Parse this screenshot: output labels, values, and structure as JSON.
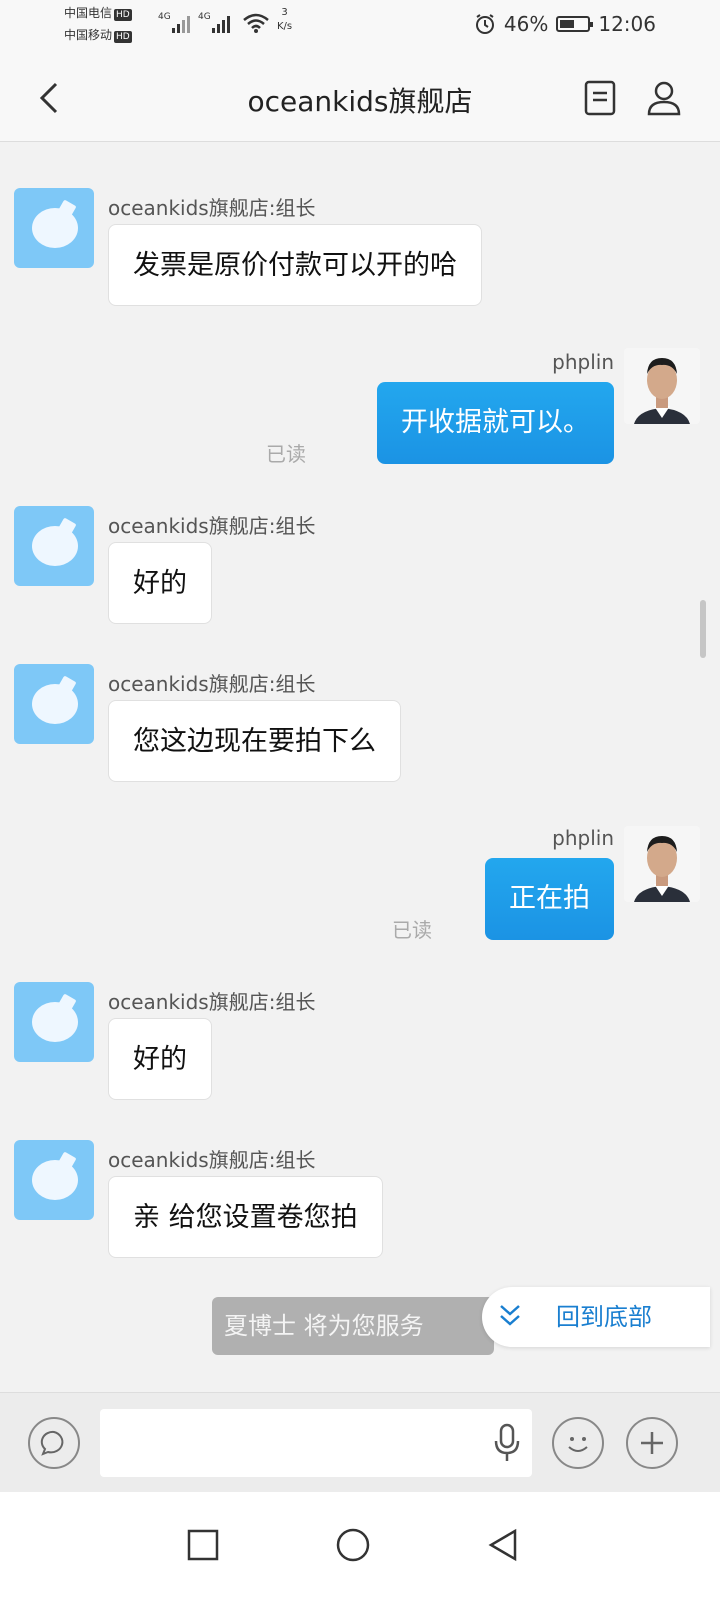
{
  "status_bar": {
    "carrier1": "中国电信",
    "carrier2": "中国移动",
    "hd": "HD",
    "net1": "4G",
    "net2": "4G",
    "speed_value": "3",
    "speed_unit": "K/s",
    "battery": "46%",
    "time": "12:06"
  },
  "header": {
    "title": "oceankids旗舰店",
    "back_icon": "chevron-left-icon",
    "menu_icon": "document-icon",
    "profile_icon": "person-icon"
  },
  "messages": [
    {
      "side": "left",
      "sender": "oceankids旗舰店:组长",
      "text": "发票是原价付款可以开的哈"
    },
    {
      "side": "right",
      "sender": "phplin",
      "text": "开收据就可以。",
      "status": "已读"
    },
    {
      "side": "left",
      "sender": "oceankids旗舰店:组长",
      "text": "好的"
    },
    {
      "side": "left",
      "sender": "oceankids旗舰店:组长",
      "text": "您这边现在要拍下么"
    },
    {
      "side": "right",
      "sender": "phplin",
      "text": "正在拍",
      "status": "已读"
    },
    {
      "side": "left",
      "sender": "oceankids旗舰店:组长",
      "text": "好的"
    },
    {
      "side": "left",
      "sender": "oceankids旗舰店:组长",
      "text": "亲 给您设置卷您拍"
    }
  ],
  "toast": "夏博士 将为您服务",
  "jump_bottom": "回到底部",
  "input": {
    "placeholder": ""
  },
  "colors": {
    "bubble_right": "#1b9ae8",
    "background": "#f2f2f2",
    "accent": "#1a7fd0"
  }
}
